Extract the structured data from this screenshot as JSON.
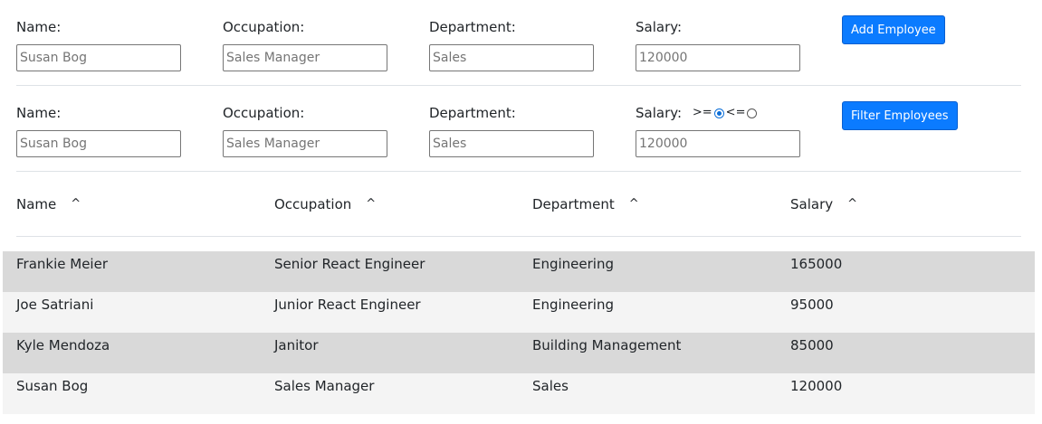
{
  "add_form": {
    "name_label": "Name:",
    "name_placeholder": "Susan Bog",
    "occupation_label": "Occupation:",
    "occupation_placeholder": "Sales Manager",
    "department_label": "Department:",
    "department_placeholder": "Sales",
    "salary_label": "Salary:",
    "salary_placeholder": "120000",
    "button_label": "Add Employee"
  },
  "filter_form": {
    "name_label": "Name:",
    "name_placeholder": "Susan Bog",
    "occupation_label": "Occupation:",
    "occupation_placeholder": "Sales Manager",
    "department_label": "Department:",
    "department_placeholder": "Sales",
    "salary_label": "Salary:",
    "salary_placeholder": "120000",
    "op_gte": ">=",
    "op_lte": "<=",
    "selected_op": "gte",
    "button_label": "Filter Employees"
  },
  "table": {
    "headers": [
      {
        "label": "Name",
        "sort": "^"
      },
      {
        "label": "Occupation",
        "sort": "^"
      },
      {
        "label": "Department",
        "sort": "^"
      },
      {
        "label": "Salary",
        "sort": "^"
      }
    ],
    "rows": [
      {
        "name": "Frankie Meier",
        "occupation": "Senior React Engineer",
        "department": "Engineering",
        "salary": "165000"
      },
      {
        "name": "Joe Satriani",
        "occupation": "Junior React Engineer",
        "department": "Engineering",
        "salary": "95000"
      },
      {
        "name": "Kyle Mendoza",
        "occupation": "Janitor",
        "department": "Building Management",
        "salary": "85000"
      },
      {
        "name": "Susan Bog",
        "occupation": "Sales Manager",
        "department": "Sales",
        "salary": "120000"
      }
    ]
  },
  "colors": {
    "primary_button": "#0b7bff",
    "row_dark": "#d9d9d9",
    "row_light": "#f4f4f4"
  }
}
